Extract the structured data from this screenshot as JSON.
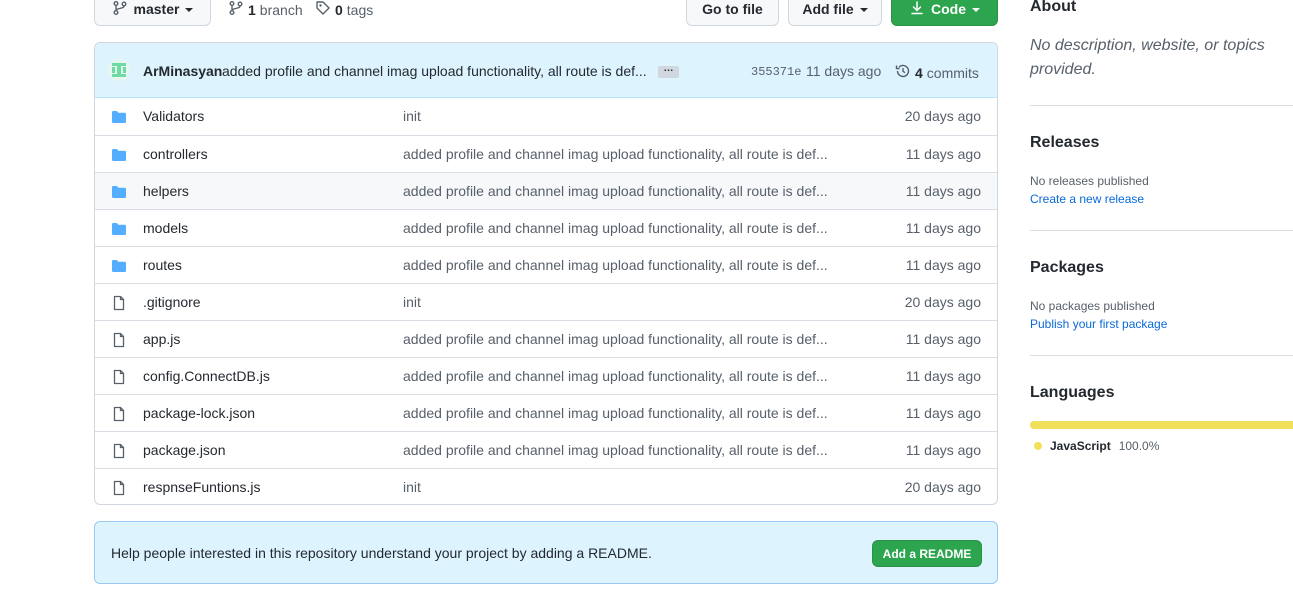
{
  "topbar": {
    "branch_label": "master",
    "branches_count": "1",
    "branches_word": "branch",
    "tags_count": "0",
    "tags_word": "tags",
    "go_to_file": "Go to file",
    "add_file": "Add file",
    "code": "Code"
  },
  "commit": {
    "author": "ArMinasyan",
    "message": "added profile and channel imag upload functionality, all route is def...",
    "ellipsis": "…",
    "sha": "355371e",
    "time": "11 days ago",
    "commits_count": "4",
    "commits_word": "commits"
  },
  "files": [
    {
      "name": "Validators",
      "type": "folder",
      "message": "init",
      "age": "20 days ago"
    },
    {
      "name": "controllers",
      "type": "folder",
      "message": "added profile and channel imag upload functionality, all route is def...",
      "age": "11 days ago"
    },
    {
      "name": "helpers",
      "type": "folder",
      "message": "added profile and channel imag upload functionality, all route is def...",
      "age": "11 days ago"
    },
    {
      "name": "models",
      "type": "folder",
      "message": "added profile and channel imag upload functionality, all route is def...",
      "age": "11 days ago"
    },
    {
      "name": "routes",
      "type": "folder",
      "message": "added profile and channel imag upload functionality, all route is def...",
      "age": "11 days ago"
    },
    {
      "name": ".gitignore",
      "type": "file",
      "message": "init",
      "age": "20 days ago"
    },
    {
      "name": "app.js",
      "type": "file",
      "message": "added profile and channel imag upload functionality, all route is def...",
      "age": "11 days ago"
    },
    {
      "name": "config.ConnectDB.js",
      "type": "file",
      "message": "added profile and channel imag upload functionality, all route is def...",
      "age": "11 days ago"
    },
    {
      "name": "package-lock.json",
      "type": "file",
      "message": "added profile and channel imag upload functionality, all route is def...",
      "age": "11 days ago"
    },
    {
      "name": "package.json",
      "type": "file",
      "message": "added profile and channel imag upload functionality, all route is def...",
      "age": "11 days ago"
    },
    {
      "name": "respnseFuntions.js",
      "type": "file",
      "message": "init",
      "age": "20 days ago"
    }
  ],
  "readme": {
    "text": "Help people interested in this repository understand your project by adding a README.",
    "button": "Add a README"
  },
  "sidebar": {
    "about_title": "About",
    "about_desc": "No description, website, or topics provided.",
    "releases_title": "Releases",
    "releases_none": "No releases published",
    "releases_link": "Create a new release",
    "packages_title": "Packages",
    "packages_none": "No packages published",
    "packages_link": "Publish your first package",
    "languages_title": "Languages",
    "language_name": "JavaScript",
    "language_pct": "100.0%"
  },
  "colors": {
    "folder": "#54aeff",
    "accent_green": "#2da44e",
    "javascript": "#f1e05a"
  }
}
